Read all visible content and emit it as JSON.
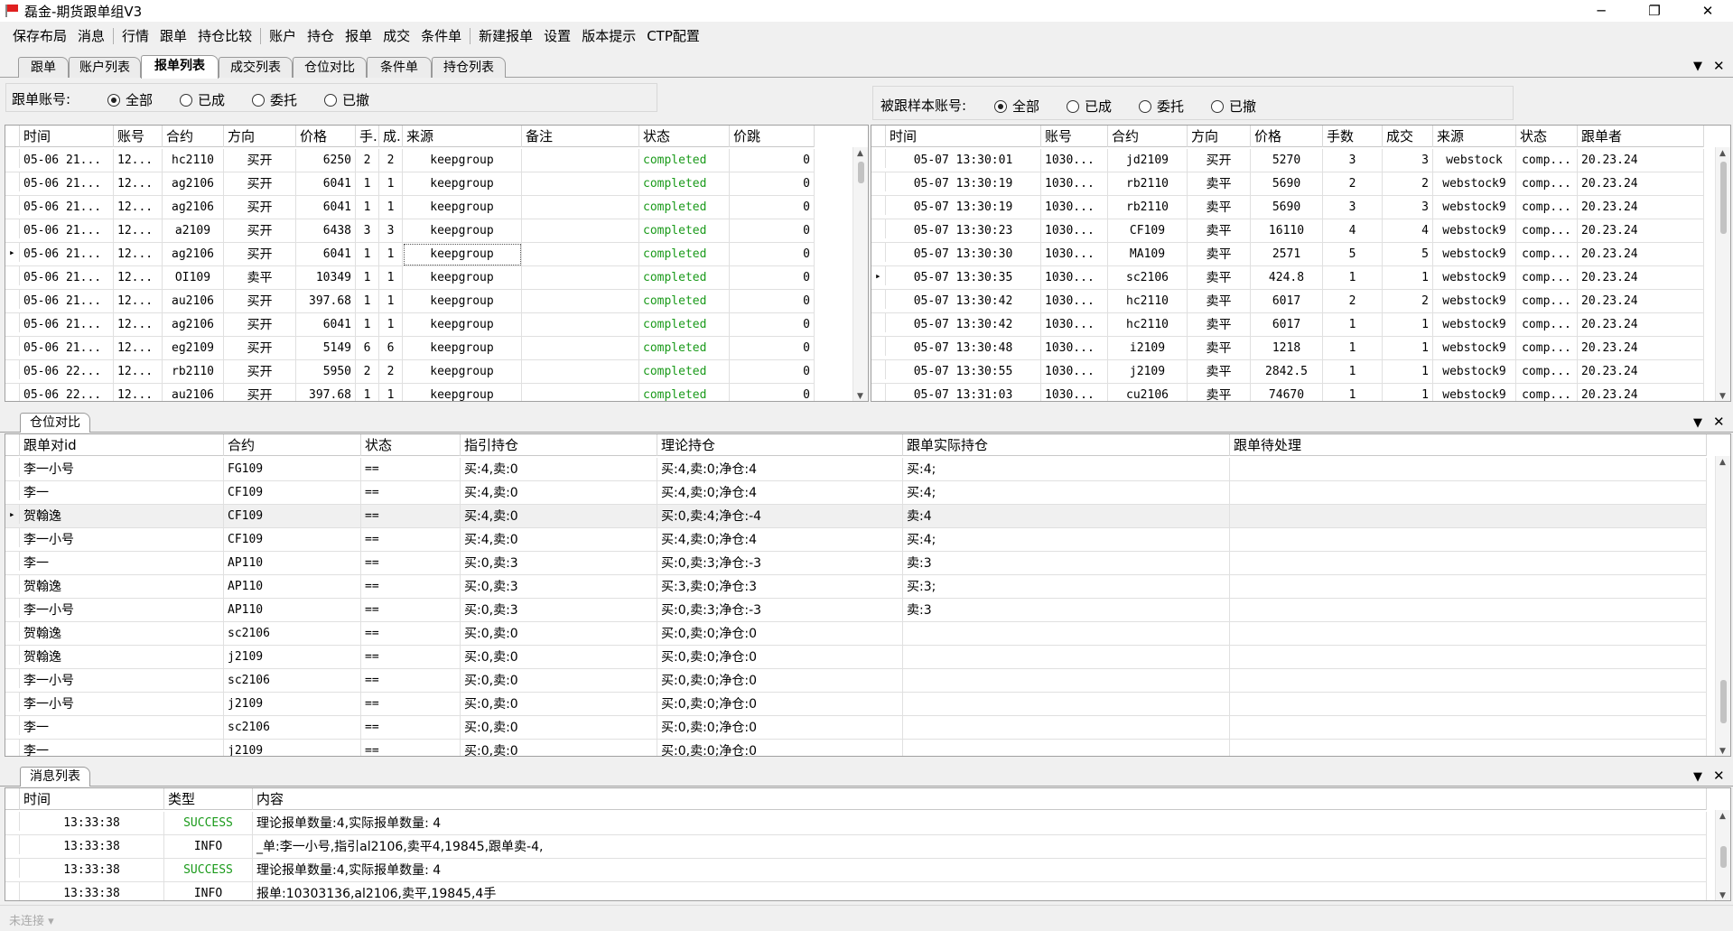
{
  "window": {
    "title": "磊金-期货跟单组V3",
    "controls": [
      "─",
      "❐",
      "✕"
    ]
  },
  "menu": [
    "保存布局",
    "消息",
    "行情",
    "跟单",
    "持仓比较",
    "账户",
    "持仓",
    "报单",
    "成交",
    "条件单",
    "新建报单",
    "设置",
    "版本提示",
    "CTP配置"
  ],
  "tabs": [
    "跟单",
    "账户列表",
    "报单列表",
    "成交列表",
    "仓位对比",
    "条件单",
    "持仓列表"
  ],
  "active_tab": "报单列表",
  "panel_controls": {
    "dropdown": "▼",
    "close": "✕"
  },
  "left_filter": {
    "label": "跟单账号:",
    "options": [
      "全部",
      "已成",
      "委托",
      "已撤"
    ],
    "selected": "全部"
  },
  "right_filter": {
    "label": "被跟样本账号:",
    "options": [
      "全部",
      "已成",
      "委托",
      "已撤"
    ],
    "selected": "全部"
  },
  "left_grid": {
    "columns": [
      "时间",
      "账号",
      "合约",
      "方向",
      "价格",
      "手.",
      "成.",
      "来源",
      "备注",
      "状态",
      "价跳"
    ],
    "rows": [
      [
        "05-06 21...",
        "12...",
        "hc2110",
        "买开",
        "6250",
        "2",
        "2",
        "keepgroup",
        "",
        "completed",
        "0"
      ],
      [
        "05-06 21...",
        "12...",
        "ag2106",
        "买开",
        "6041",
        "1",
        "1",
        "keepgroup",
        "",
        "completed",
        "0"
      ],
      [
        "05-06 21...",
        "12...",
        "ag2106",
        "买开",
        "6041",
        "1",
        "1",
        "keepgroup",
        "",
        "completed",
        "0"
      ],
      [
        "05-06 21...",
        "12...",
        "a2109",
        "买开",
        "6438",
        "3",
        "3",
        "keepgroup",
        "",
        "completed",
        "0"
      ],
      [
        "05-06 21...",
        "12...",
        "ag2106",
        "买开",
        "6041",
        "1",
        "1",
        "keepgroup",
        "",
        "completed",
        "0"
      ],
      [
        "05-06 21...",
        "12...",
        "OI109",
        "卖平",
        "10349",
        "1",
        "1",
        "keepgroup",
        "",
        "completed",
        "0"
      ],
      [
        "05-06 21...",
        "12...",
        "au2106",
        "买开",
        "397.68",
        "1",
        "1",
        "keepgroup",
        "",
        "completed",
        "0"
      ],
      [
        "05-06 21...",
        "12...",
        "ag2106",
        "买开",
        "6041",
        "1",
        "1",
        "keepgroup",
        "",
        "completed",
        "0"
      ],
      [
        "05-06 21...",
        "12...",
        "eg2109",
        "买开",
        "5149",
        "6",
        "6",
        "keepgroup",
        "",
        "completed",
        "0"
      ],
      [
        "05-06 22...",
        "12...",
        "rb2110",
        "买开",
        "5950",
        "2",
        "2",
        "keepgroup",
        "",
        "completed",
        "0"
      ],
      [
        "05-06 22...",
        "12...",
        "au2106",
        "买开",
        "397.68",
        "1",
        "1",
        "keepgroup",
        "",
        "completed",
        "0"
      ]
    ]
  },
  "right_grid": {
    "columns": [
      "时间",
      "账号",
      "合约",
      "方向",
      "价格",
      "手数",
      "成交",
      "来源",
      "状态",
      "跟单者"
    ],
    "rows": [
      [
        "05-07 13:30:01",
        "1030...",
        "jd2109",
        "买开",
        "5270",
        "3",
        "3",
        "webstock",
        "comp...",
        "20.23.24"
      ],
      [
        "05-07 13:30:19",
        "1030...",
        "rb2110",
        "卖平",
        "5690",
        "2",
        "2",
        "webstock9",
        "comp...",
        "20.23.24"
      ],
      [
        "05-07 13:30:19",
        "1030...",
        "rb2110",
        "卖平",
        "5690",
        "3",
        "3",
        "webstock9",
        "comp...",
        "20.23.24"
      ],
      [
        "05-07 13:30:23",
        "1030...",
        "CF109",
        "卖平",
        "16110",
        "4",
        "4",
        "webstock9",
        "comp...",
        "20.23.24"
      ],
      [
        "05-07 13:30:30",
        "1030...",
        "MA109",
        "卖平",
        "2571",
        "5",
        "5",
        "webstock9",
        "comp...",
        "20.23.24"
      ],
      [
        "05-07 13:30:35",
        "1030...",
        "sc2106",
        "卖平",
        "424.8",
        "1",
        "1",
        "webstock9",
        "comp...",
        "20.23.24"
      ],
      [
        "05-07 13:30:42",
        "1030...",
        "hc2110",
        "卖平",
        "6017",
        "2",
        "2",
        "webstock9",
        "comp...",
        "20.23.24"
      ],
      [
        "05-07 13:30:42",
        "1030...",
        "hc2110",
        "卖平",
        "6017",
        "1",
        "1",
        "webstock9",
        "comp...",
        "20.23.24"
      ],
      [
        "05-07 13:30:48",
        "1030...",
        "i2109",
        "卖平",
        "1218",
        "1",
        "1",
        "webstock9",
        "comp...",
        "20.23.24"
      ],
      [
        "05-07 13:30:55",
        "1030...",
        "j2109",
        "卖平",
        "2842.5",
        "1",
        "1",
        "webstock9",
        "comp...",
        "20.23.24"
      ],
      [
        "05-07 13:31:03",
        "1030...",
        "cu2106",
        "卖平",
        "74670",
        "1",
        "1",
        "webstock9",
        "comp...",
        "20.23.24"
      ]
    ]
  },
  "position_panel": {
    "tab": "仓位对比",
    "columns": [
      "跟单对id",
      "合约",
      "状态",
      "指引持仓",
      "理论持仓",
      "跟单实际持仓",
      "跟单待处理"
    ],
    "rows": [
      [
        "李一小号",
        "FG109",
        "==",
        "买:4,卖:0",
        "买:4,卖:0;净仓:4",
        "买:4;",
        ""
      ],
      [
        "李一",
        "CF109",
        "==",
        "买:4,卖:0",
        "买:4,卖:0;净仓:4",
        "买:4;",
        ""
      ],
      [
        "贺翰逸",
        "CF109",
        "==",
        "买:4,卖:0",
        "买:0,卖:4;净仓:-4",
        "卖:4",
        ""
      ],
      [
        "李一小号",
        "CF109",
        "==",
        "买:4,卖:0",
        "买:4,卖:0;净仓:4",
        "买:4;",
        ""
      ],
      [
        "李一",
        "AP110",
        "==",
        "买:0,卖:3",
        "买:0,卖:3;净仓:-3",
        "卖:3",
        ""
      ],
      [
        "贺翰逸",
        "AP110",
        "==",
        "买:0,卖:3",
        "买:3,卖:0;净仓:3",
        "买:3;",
        ""
      ],
      [
        "李一小号",
        "AP110",
        "==",
        "买:0,卖:3",
        "买:0,卖:3;净仓:-3",
        "卖:3",
        ""
      ],
      [
        "贺翰逸",
        "sc2106",
        "==",
        "买:0,卖:0",
        "买:0,卖:0;净仓:0",
        "",
        ""
      ],
      [
        "贺翰逸",
        "j2109",
        "==",
        "买:0,卖:0",
        "买:0,卖:0;净仓:0",
        "",
        ""
      ],
      [
        "李一小号",
        "sc2106",
        "==",
        "买:0,卖:0",
        "买:0,卖:0;净仓:0",
        "",
        ""
      ],
      [
        "李一小号",
        "j2109",
        "==",
        "买:0,卖:0",
        "买:0,卖:0;净仓:0",
        "",
        ""
      ],
      [
        "李一",
        "sc2106",
        "==",
        "买:0,卖:0",
        "买:0,卖:0;净仓:0",
        "",
        ""
      ],
      [
        "李一",
        "j2109",
        "==",
        "买:0,卖:0",
        "买:0,卖:0;净仓:0",
        "",
        ""
      ]
    ]
  },
  "message_panel": {
    "tab": "消息列表",
    "columns": [
      "时间",
      "类型",
      "内容"
    ],
    "rows": [
      [
        "13:33:38",
        "SUCCESS",
        "理论报单数量:4,实际报单数量: 4"
      ],
      [
        "13:33:38",
        "INFO",
        "_单:李一小号,指引al2106,卖平4,19845,跟单卖-4,"
      ],
      [
        "13:33:38",
        "SUCCESS",
        "理论报单数量:4,实际报单数量: 4"
      ],
      [
        "13:33:38",
        "INFO",
        "报单:10303136,al2106,卖平,19845,4手"
      ]
    ]
  },
  "status_bar": {
    "text": "未连接 ▾"
  },
  "colors": {
    "success": "#1a9a1a",
    "completed": "#1a9a1a",
    "flag": "#e02020"
  }
}
